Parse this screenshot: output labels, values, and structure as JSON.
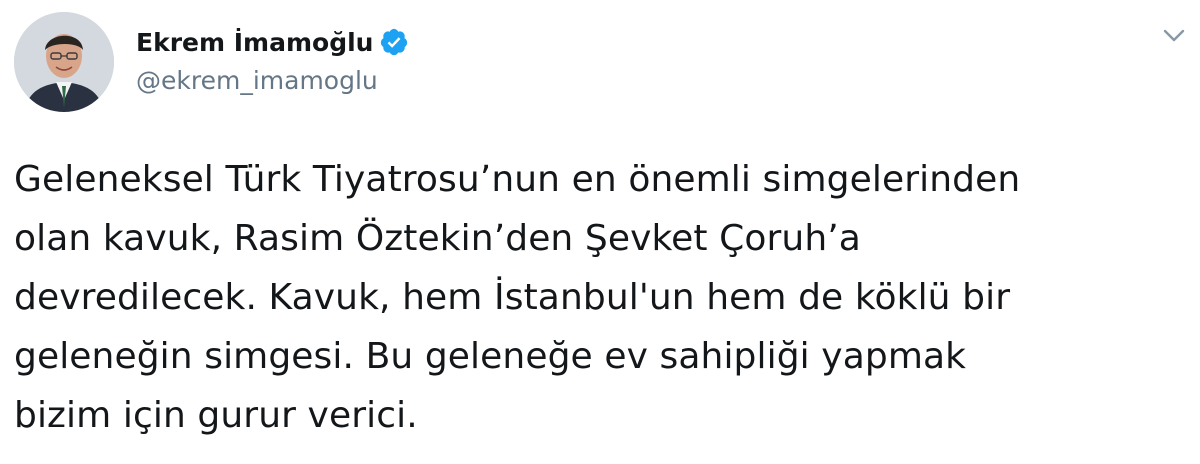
{
  "tweet": {
    "author": {
      "display_name": "Ekrem İmamoğlu",
      "handle": "@ekrem_imamoglu",
      "verified": true,
      "avatar_icon": "profile-photo"
    },
    "menu_icon": "chevron-down-icon",
    "text_lines": [
      "Geleneksel Türk Tiyatrosu’nun en önemli simgelerinden",
      "olan kavuk, Rasim Öztekin’den Şevket Çoruh’a",
      "devredilecek. Kavuk, hem İstanbul'un hem de köklü bir",
      "geleneğin simgesi. Bu geleneğe ev sahipliği yapmak",
      "bizim için gurur verici."
    ]
  },
  "colors": {
    "text": "#14171a",
    "secondary_text": "#657786",
    "verified_badge": "#1da1f2",
    "caret": "#8899a6"
  }
}
